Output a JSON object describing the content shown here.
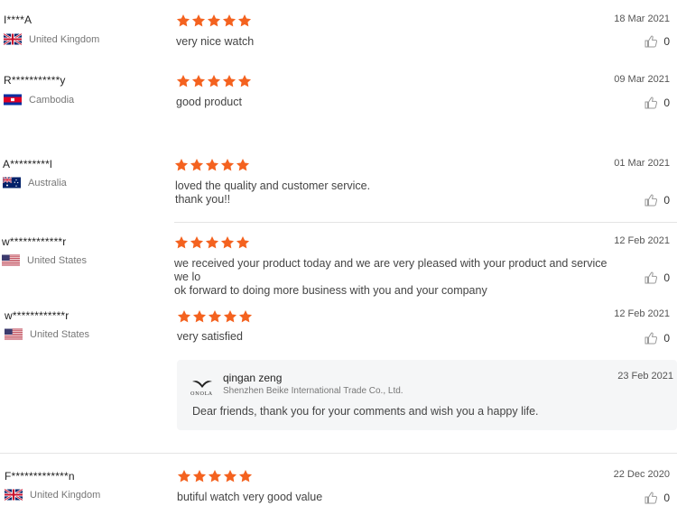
{
  "reviews": [
    {
      "user": "I****A",
      "country": "United Kingdom",
      "flag": "uk-flag-icon",
      "rating": 5,
      "text": [
        "very nice watch"
      ],
      "date": "18 Mar 2021",
      "likes": "0"
    },
    {
      "user": "R***********y",
      "country": "Cambodia",
      "flag": "cambodia-flag-icon",
      "rating": 5,
      "text": [
        "good product"
      ],
      "date": "09 Mar 2021",
      "likes": "0"
    },
    {
      "user": "A*********l",
      "country": "Australia",
      "flag": "australia-flag-icon",
      "rating": 5,
      "text": [
        "loved the quality and customer service.",
        "thank you!!"
      ],
      "date": "01 Mar 2021",
      "likes": "0"
    },
    {
      "user": "w************r",
      "country": "United States",
      "flag": "us-flag-icon",
      "rating": 5,
      "text": [
        "we received your product today and we are very pleased with your product and service we lo",
        "ok forward to doing more business with you and your company"
      ],
      "date": "12 Feb 2021",
      "likes": "0"
    },
    {
      "user": "w************r",
      "country": "United States",
      "flag": "us-flag-icon",
      "rating": 5,
      "text": [
        "very satisfied"
      ],
      "date": "12 Feb 2021",
      "likes": "0"
    },
    {
      "user": "F*************n",
      "country": "United Kingdom",
      "flag": "uk-flag-icon",
      "rating": 5,
      "text": [
        "butiful watch very good value"
      ],
      "date": "22 Dec 2020",
      "likes": "0"
    }
  ],
  "seller_reply": {
    "logo_text": "ONOLA",
    "name": "qingan zeng",
    "company": "Shenzhen Beike International Trade Co., Ltd.",
    "date": "23 Feb 2021",
    "text": "Dear friends, thank you for your comments and wish you a happy life."
  },
  "colors": {
    "star": "#f4621f",
    "divider": "#e4e4e4",
    "reply_bg": "#f5f6f7"
  }
}
